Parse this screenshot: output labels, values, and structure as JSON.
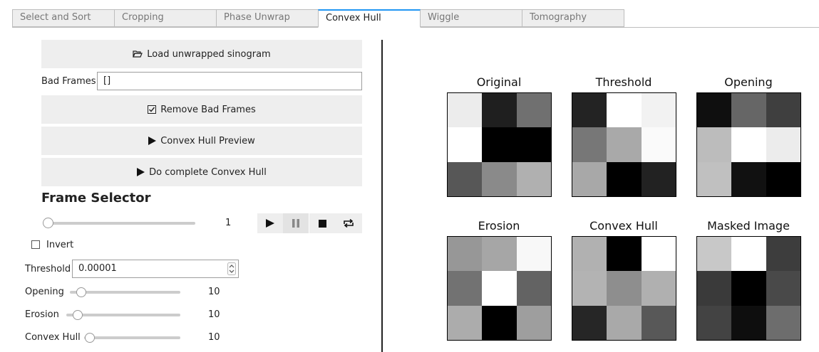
{
  "tabs": [
    {
      "label": "Select and Sort"
    },
    {
      "label": "Cropping"
    },
    {
      "label": "Phase Unwrap"
    },
    {
      "label": "Convex Hull"
    },
    {
      "label": "Wiggle"
    },
    {
      "label": "Tomography"
    }
  ],
  "active_tab": "Convex Hull",
  "buttons": {
    "load": "Load unwrapped sinogram",
    "remove_bad": "Remove Bad Frames",
    "preview": "Convex Hull Preview",
    "complete": "Do complete Convex Hull"
  },
  "bad_frames": {
    "label": "Bad Frames",
    "value": "[]"
  },
  "frame_selector": {
    "title": "Frame Selector",
    "value": "1",
    "level": 0
  },
  "invert": {
    "label": "Invert",
    "checked": false
  },
  "threshold": {
    "label": "Threshold",
    "value": "0.00001"
  },
  "sliders": {
    "opening": {
      "label": "Opening",
      "value": "10"
    },
    "erosion": {
      "label": "Erosion",
      "value": "10"
    },
    "convex_hull": {
      "label": "Convex Hull",
      "value": "10"
    }
  },
  "panels": [
    {
      "title": "Original",
      "cells": [
        "#ececec",
        "#1f1f1f",
        "#707070",
        "#ffffff",
        "#000000",
        "#000000",
        "#575757",
        "#8a8a8a",
        "#b0b0b0"
      ]
    },
    {
      "title": "Threshold",
      "cells": [
        "#232323",
        "#ffffff",
        "#f2f2f2",
        "#777777",
        "#a9a9a9",
        "#fafafa",
        "#a8a8a8",
        "#000000",
        "#222222"
      ]
    },
    {
      "title": "Opening",
      "cells": [
        "#0f0f0f",
        "#666666",
        "#3f3f3f",
        "#bcbcbc",
        "#ffffff",
        "#ececec",
        "#c0c0c0",
        "#111111",
        "#000000"
      ]
    },
    {
      "title": "Erosion",
      "cells": [
        "#979797",
        "#a6a6a6",
        "#f8f8f8",
        "#727272",
        "#ffffff",
        "#636363",
        "#acacac",
        "#000000",
        "#9e9e9e"
      ]
    },
    {
      "title": "Convex Hull",
      "cells": [
        "#b1b1b1",
        "#000000",
        "#ffffff",
        "#b3b3b3",
        "#8e8e8e",
        "#b0b0b0",
        "#262626",
        "#a9a9a9",
        "#585858"
      ]
    },
    {
      "title": "Masked Image",
      "cells": [
        "#c8c8c8",
        "#ffffff",
        "#3d3d3d",
        "#3a3a3a",
        "#000000",
        "#494949",
        "#434343",
        "#0e0e0e",
        "#6d6d6d"
      ]
    }
  ]
}
